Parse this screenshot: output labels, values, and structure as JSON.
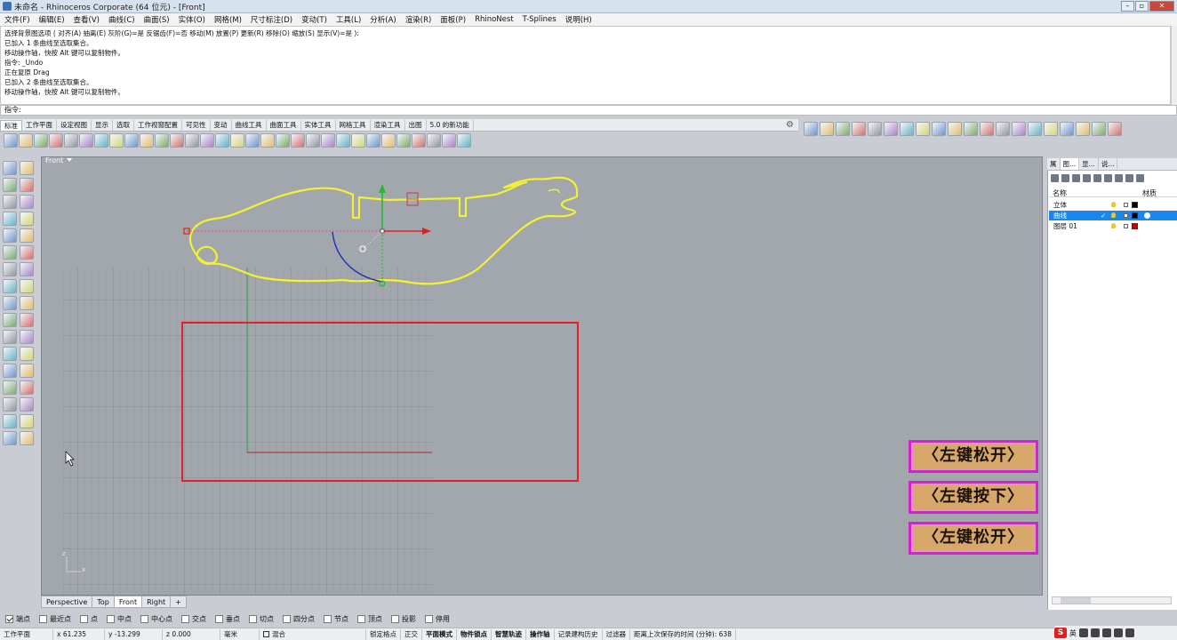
{
  "window": {
    "title": "未命名 - Rhinoceros Corporate (64 位元) - [Front]",
    "controls": [
      "minimize",
      "restore",
      "close"
    ]
  },
  "menu": [
    "文件(F)",
    "编辑(E)",
    "查看(V)",
    "曲线(C)",
    "曲面(S)",
    "实体(O)",
    "网格(M)",
    "尺寸标注(D)",
    "变动(T)",
    "工具(L)",
    "分析(A)",
    "渲染(R)",
    "面板(P)",
    "RhinoNest",
    "T-Splines",
    "说明(H)"
  ],
  "history": [
    "选择背景图选项 ( 对齐(A)  抽离(E)  灰阶(G)=是  反锯齿(F)=否  移动(M)  放置(P)  更新(R)  移除(O)  缩放(S)  显示(V)=是 ):",
    "已加入 1 条曲线至选取集合。",
    "移动操作轴，快按 Alt 键可以复制物件。",
    "指令: _Undo",
    "正在复原 Drag",
    "已加入 2 条曲线至选取集合。",
    "移动操作轴，快按 Alt 键可以复制物件。"
  ],
  "command_prompt": "指令:",
  "tool_tabs": [
    "标准",
    "工作平面",
    "设定视图",
    "显示",
    "选取",
    "工作视窗配置",
    "可见性",
    "变动",
    "曲线工具",
    "曲面工具",
    "实体工具",
    "网格工具",
    "渲染工具",
    "出图",
    "5.0 的新功能"
  ],
  "tool_tabs_active": 0,
  "main_toolbar_icons": [
    "new-icon",
    "open-icon",
    "save-icon",
    "print-icon",
    "import-icon",
    "cut-icon",
    "copy-icon",
    "paste-icon",
    "undo-icon",
    "pan-icon",
    "move-view-icon",
    "zoom-icon",
    "zoom-window-icon",
    "zoom-extents-icon",
    "zoom-selected-icon",
    "rotate-view-icon",
    "four-view-icon",
    "set-cplane-icon",
    "grid-snap-icon",
    "shade-icon",
    "light-icon",
    "lock-icon",
    "material-icon",
    "render-icon",
    "sphere-shaded-icon",
    "sphere-ghosted-icon",
    "sphere-render-icon",
    "sphere-icon",
    "options-icon",
    "properties-icon",
    "help-icon"
  ],
  "right_toolbar_icons": [
    "solid-box-icon",
    "cylinder-icon",
    "plane-icon",
    "extrude-icon",
    "cube-icon",
    "sweep-icon",
    "blend-icon",
    "loft-icon",
    "network-icon",
    "revolve-icon",
    "patch-icon",
    "fillet-icon",
    "edge-icon",
    "offset-icon",
    "boolean-icon",
    "mesh-icon",
    "cap-icon",
    "shell-icon",
    "split-icon",
    "explode-icon"
  ],
  "left_toolbar_icons": [
    "select-arrow-icon",
    "point-icon",
    "line-icon",
    "polyline-icon",
    "circle-icon",
    "arc-icon",
    "triangle-icon",
    "rectangle-icon",
    "ellipse-icon",
    "curve-icon",
    "box-icon",
    "sphere-tool-icon",
    "cylinder-tool-icon",
    "cone-tool-icon",
    "surface-icon",
    "extrude-tool-icon",
    "boolean-tool-icon",
    "fillet-tool-icon",
    "trim-icon",
    "split-tool-icon",
    "join-icon",
    "explode-tool-icon",
    "array-icon",
    "scale-icon",
    "text-icon",
    "dimension-icon",
    "group-icon",
    "block-icon",
    "mesh-tool-icon",
    "analyze-icon",
    "render-tool-icon",
    "checkmark-icon",
    "material-tool-icon",
    "paint-icon"
  ],
  "viewport": {
    "name": "Front",
    "tabs": [
      "Perspective",
      "Top",
      "Front",
      "Right"
    ],
    "active_tab": 2,
    "add_tab": "+",
    "axis_labels": {
      "x": "x",
      "z": "z"
    }
  },
  "osnaps": [
    {
      "label": "端点",
      "checked": true
    },
    {
      "label": "最近点",
      "checked": false
    },
    {
      "label": "点",
      "checked": false
    },
    {
      "label": "中点",
      "checked": false
    },
    {
      "label": "中心点",
      "checked": false
    },
    {
      "label": "交点",
      "checked": false
    },
    {
      "label": "垂点",
      "checked": false
    },
    {
      "label": "切点",
      "checked": false
    },
    {
      "label": "四分点",
      "checked": false
    },
    {
      "label": "节点",
      "checked": false
    },
    {
      "label": "顶点",
      "checked": false
    },
    {
      "label": "投影",
      "checked": false
    },
    {
      "label": "停用",
      "checked": false
    }
  ],
  "status": {
    "cplane": "工作平面",
    "x": "x 61.235",
    "y": "y -13.299",
    "z": "z 0.000",
    "unit": "毫米",
    "layer": "混合",
    "items": [
      "锁定格点",
      "正交",
      "平面模式",
      "物件锁点",
      "智慧轨迹",
      "操作轴",
      "记录建构历史",
      "过滤器"
    ],
    "bold_items": [
      "平面模式",
      "物件锁点",
      "智慧轨迹",
      "操作轴"
    ],
    "autosave": "距离上次保存的时间 (分钟): 638"
  },
  "right_panel": {
    "tabs": [
      "属",
      "图...",
      "显...",
      "说..."
    ],
    "active_tab": 1,
    "columns": {
      "name": "名称",
      "material": "材质"
    },
    "layers": [
      {
        "name": "立体",
        "color": "#000000",
        "selected": false,
        "current": false
      },
      {
        "name": "曲线",
        "color": "#000000",
        "selected": true,
        "current": true
      },
      {
        "name": "图层 01",
        "color": "#cc0000",
        "selected": false,
        "current": false
      }
    ]
  },
  "overlay_buttons": [
    "〈左键松开〉",
    "〈左键按下〉",
    "〈左键松开〉"
  ],
  "tray": {
    "ime": "S",
    "lang": "英"
  },
  "colors": {
    "viewport_bg": "#a2a6ad",
    "curve_yellow": "#f2f230",
    "rect_red": "#e0202a",
    "gumball_green": "#22bb33",
    "gumball_red": "#e02020",
    "selection_blue": "#1b86f0",
    "overlay_border": "#d424c7",
    "overlay_fill": "#d8a76a"
  }
}
